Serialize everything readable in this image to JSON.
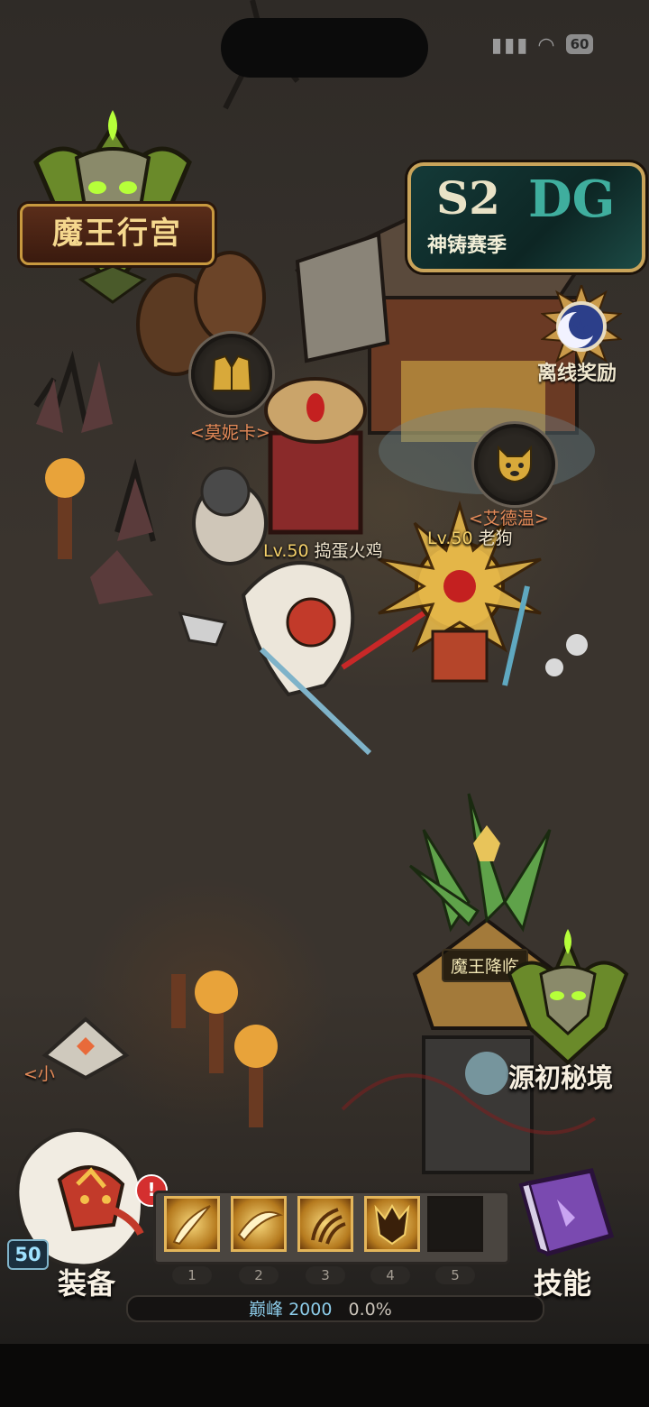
{
  "status_bar": {
    "battery": "60"
  },
  "palace": {
    "title": "魔王行宫"
  },
  "season": {
    "code": "S2",
    "logo": "DG",
    "label": "神铸赛季"
  },
  "offline_reward": {
    "label": "离线奖励"
  },
  "npcs": [
    {
      "name": "<莫妮卡>"
    },
    {
      "name": "<艾德温>"
    },
    {
      "name": "<小"
    }
  ],
  "characters": [
    {
      "level": "Lv.50",
      "name": "捣蛋火鸡"
    },
    {
      "level": "Lv.50",
      "name": "老狗"
    }
  ],
  "map_marks": {
    "demon_arrival": "魔王降临",
    "origin_realm": "源初秘境"
  },
  "hud": {
    "player_level": "50",
    "alert": "!",
    "equip_label": "装备",
    "skills_label": "技能",
    "skill_slots": [
      "1",
      "2",
      "3",
      "4",
      "5"
    ],
    "xp_label": "巅峰",
    "xp_value": "2000",
    "xp_percent": "0.0%"
  },
  "colors": {
    "gold": "#c8993f",
    "accent_orange": "#e48a58",
    "teal": "#3fae9e"
  }
}
